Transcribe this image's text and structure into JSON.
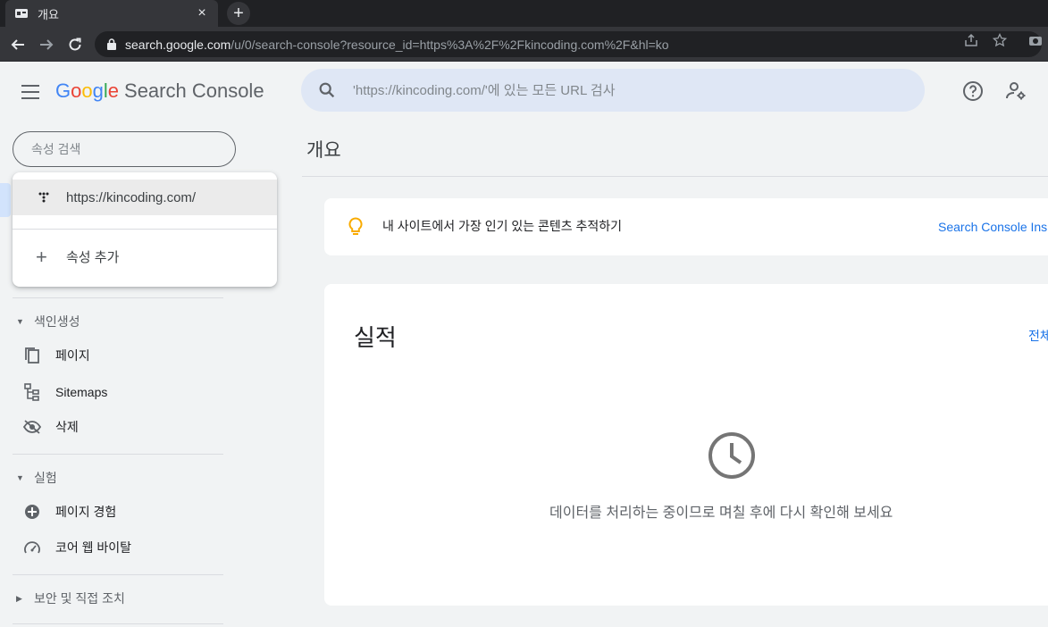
{
  "browser": {
    "tab_title": "개요",
    "tab_close": "×",
    "new_tab": "+",
    "url_host": "search.google.com",
    "url_path": "/u/0/search-console?resource_id=https%3A%2F%2Fkincoding.com%2F&hl=ko"
  },
  "header": {
    "logo": {
      "g1": "G",
      "o1": "o",
      "o2": "o",
      "g2": "g",
      "l": "l",
      "e": "e",
      "product": "Search Console"
    },
    "search_placeholder": "'https://kincoding.com/'에 있는 모든 URL 검사"
  },
  "sidebar": {
    "property_search_placeholder": "속성 검색",
    "sections": [
      {
        "label": "색인생성",
        "expanded": true,
        "items": [
          {
            "label": "페이지",
            "icon": "pages-icon"
          },
          {
            "label": "Sitemaps",
            "icon": "sitemap-icon"
          },
          {
            "label": "삭제",
            "icon": "removals-icon"
          }
        ]
      },
      {
        "label": "실험",
        "expanded": true,
        "items": [
          {
            "label": "페이지 경험",
            "icon": "page-experience-icon"
          },
          {
            "label": "코어 웹 바이탈",
            "icon": "speed-gauge-icon"
          }
        ]
      },
      {
        "label": "보안 및 직접 조치",
        "expanded": false,
        "items": []
      }
    ]
  },
  "property_dropdown": {
    "selected_property": "https://kincoding.com/",
    "add_property": "속성 추가"
  },
  "main": {
    "page_title": "개요",
    "tip": {
      "text": "내 사이트에서 가장 인기 있는 콘텐츠 추적하기",
      "link": "Search Console Ins"
    },
    "performance": {
      "title": "실적",
      "link": "전체",
      "message": "데이터를 처리하는 중이므로 며칠 후에 다시 확인해 보세요"
    }
  },
  "colors": {
    "accent": "#1a73e8",
    "bulb": "#f9ab00",
    "search_bg": "#dfe7f5",
    "page_bg": "#f1f3f4"
  }
}
